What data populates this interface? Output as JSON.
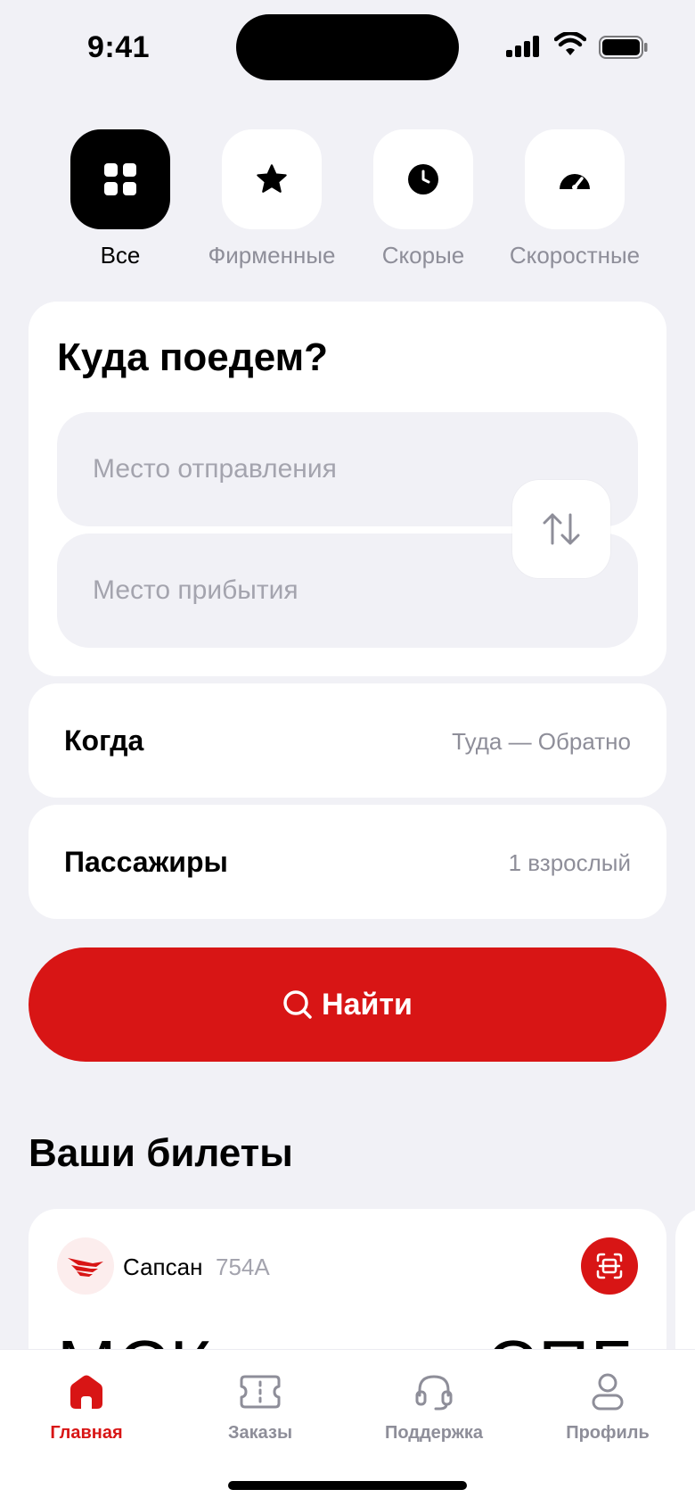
{
  "status_bar": {
    "time": "9:41"
  },
  "categories": [
    {
      "label": "Все",
      "icon": "grid-icon",
      "active": true
    },
    {
      "label": "Фирменные",
      "icon": "star-icon",
      "active": false
    },
    {
      "label": "Скорые",
      "icon": "clock-icon",
      "active": false
    },
    {
      "label": "Скоростные",
      "icon": "speedometer-icon",
      "active": false
    }
  ],
  "search": {
    "title": "Куда поедем?",
    "from_placeholder": "Место отправления",
    "to_placeholder": "Место прибытия",
    "when_label": "Когда",
    "when_value": "Туда — Обратно",
    "passengers_label": "Пассажиры",
    "passengers_value": "1 взрослый",
    "find_label": "Найти"
  },
  "tickets": {
    "title": "Ваши билеты",
    "items": [
      {
        "train_name": "Сапсан",
        "train_number": "754А",
        "from": "МСК",
        "to": "СПБ"
      }
    ]
  },
  "tab_bar": [
    {
      "label": "Главная",
      "icon": "home-icon",
      "active": true
    },
    {
      "label": "Заказы",
      "icon": "ticket-icon",
      "active": false
    },
    {
      "label": "Поддержка",
      "icon": "headset-icon",
      "active": false
    },
    {
      "label": "Профиль",
      "icon": "user-icon",
      "active": false
    }
  ],
  "colors": {
    "accent": "#D81515",
    "background": "#F1F1F6",
    "muted": "#8E8E99"
  }
}
